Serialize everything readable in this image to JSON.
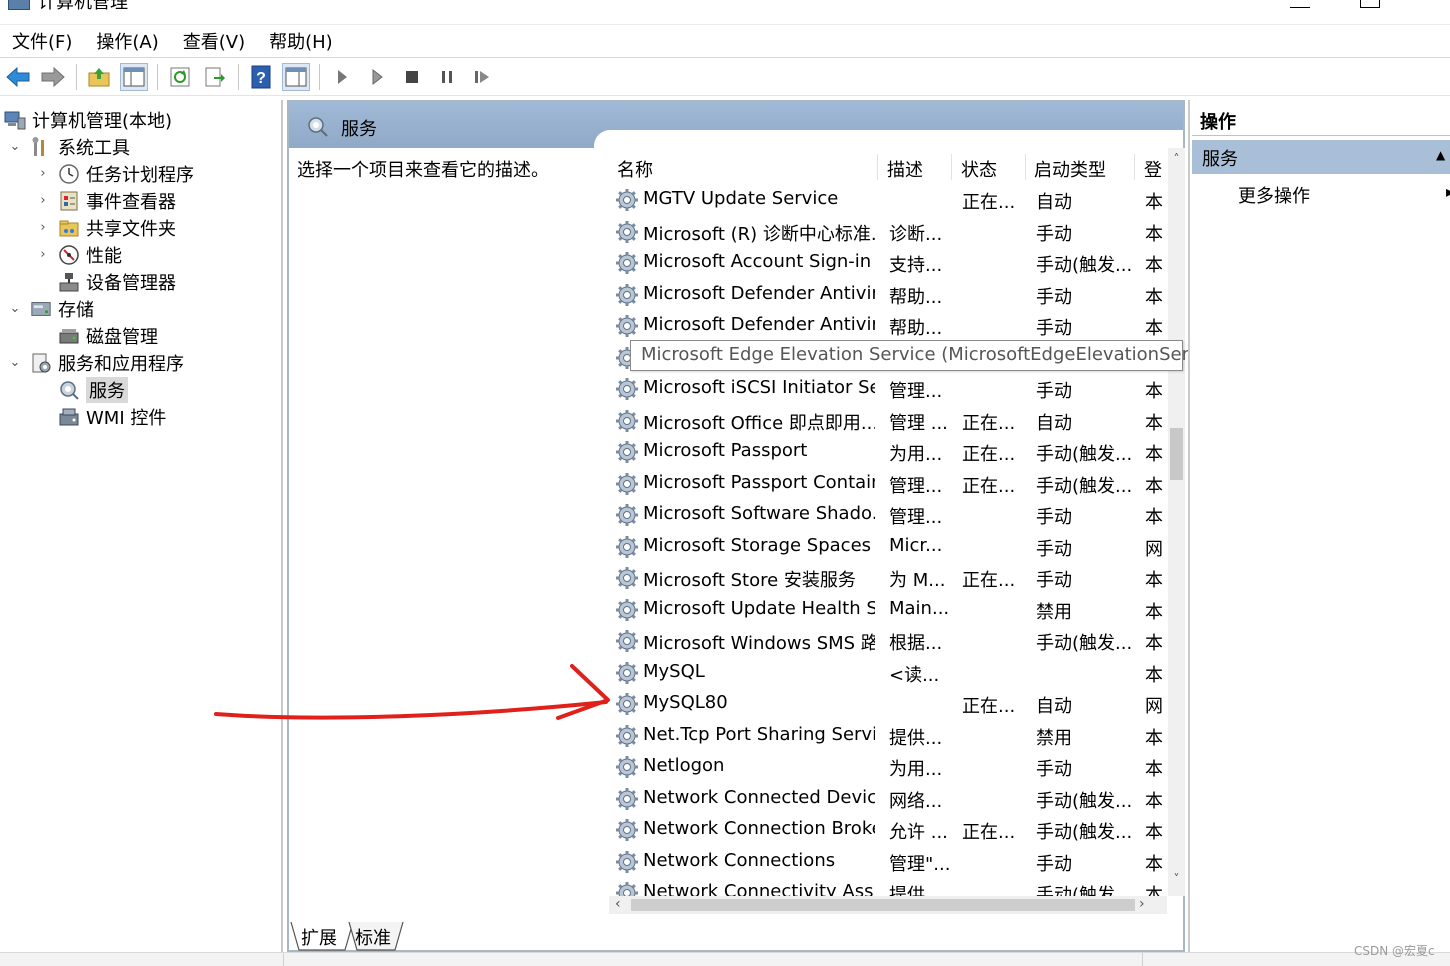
{
  "window": {
    "title": "计算机管理"
  },
  "menubar": [
    "文件(F)",
    "操作(A)",
    "查看(V)",
    "帮助(H)"
  ],
  "tree": {
    "root": "计算机管理(本地)",
    "system_tools": "系统工具",
    "task_scheduler": "任务计划程序",
    "event_viewer": "事件查看器",
    "shared_folders": "共享文件夹",
    "performance": "性能",
    "device_manager": "设备管理器",
    "storage": "存储",
    "disk_management": "磁盘管理",
    "services_apps": "服务和应用程序",
    "services": "服务",
    "wmi": "WMI 控件"
  },
  "center": {
    "title": "服务",
    "description": "选择一个项目来查看它的描述。",
    "columns": {
      "name": "名称",
      "desc": "描述",
      "status": "状态",
      "startup": "启动类型",
      "logon": "登"
    },
    "rows": [
      {
        "name": "MGTV Update Service",
        "desc": "",
        "status": "正在...",
        "startup": "自动",
        "logon": "本"
      },
      {
        "name": "Microsoft (R) 诊断中心标准...",
        "desc": "诊断...",
        "status": "",
        "startup": "手动",
        "logon": "本"
      },
      {
        "name": "Microsoft Account Sign-in ...",
        "desc": "支持...",
        "status": "",
        "startup": "手动(触发...",
        "logon": "本"
      },
      {
        "name": "Microsoft Defender Antivir...",
        "desc": "帮助...",
        "status": "",
        "startup": "手动",
        "logon": "本"
      },
      {
        "name": "Microsoft Defender Antivir...",
        "desc": "帮助...",
        "status": "",
        "startup": "手动",
        "logon": "本"
      },
      {
        "name": "",
        "desc": "",
        "status": "",
        "startup": "",
        "logon": ""
      },
      {
        "name": "Microsoft iSCSI Initiator Ser...",
        "desc": "管理...",
        "status": "",
        "startup": "手动",
        "logon": "本"
      },
      {
        "name": "Microsoft Office 即点即用...",
        "desc": "管理 ...",
        "status": "正在...",
        "startup": "自动",
        "logon": "本"
      },
      {
        "name": "Microsoft Passport",
        "desc": "为用...",
        "status": "正在...",
        "startup": "手动(触发...",
        "logon": "本"
      },
      {
        "name": "Microsoft Passport Container",
        "desc": "管理...",
        "status": "正在...",
        "startup": "手动(触发...",
        "logon": "本"
      },
      {
        "name": "Microsoft Software Shado...",
        "desc": "管理...",
        "status": "",
        "startup": "手动",
        "logon": "本"
      },
      {
        "name": "Microsoft Storage Spaces S...",
        "desc": "Micr...",
        "status": "",
        "startup": "手动",
        "logon": "网"
      },
      {
        "name": "Microsoft Store 安装服务",
        "desc": "为 M...",
        "status": "正在...",
        "startup": "手动",
        "logon": "本"
      },
      {
        "name": "Microsoft Update Health S...",
        "desc": "Main...",
        "status": "",
        "startup": "禁用",
        "logon": "本"
      },
      {
        "name": "Microsoft Windows SMS 路...",
        "desc": "根据...",
        "status": "",
        "startup": "手动(触发...",
        "logon": "本"
      },
      {
        "name": "MySQL",
        "desc": "<读...",
        "status": "",
        "startup": "",
        "logon": "本"
      },
      {
        "name": "MySQL80",
        "desc": "",
        "status": "正在...",
        "startup": "自动",
        "logon": "网"
      },
      {
        "name": "Net.Tcp Port Sharing Service",
        "desc": "提供...",
        "status": "",
        "startup": "禁用",
        "logon": "本"
      },
      {
        "name": "Netlogon",
        "desc": "为用...",
        "status": "",
        "startup": "手动",
        "logon": "本"
      },
      {
        "name": "Network Connected Devic...",
        "desc": "网络...",
        "status": "",
        "startup": "手动(触发...",
        "logon": "本"
      },
      {
        "name": "Network Connection Broker",
        "desc": "允许 ...",
        "status": "正在...",
        "startup": "手动(触发...",
        "logon": "本"
      },
      {
        "name": "Network Connections",
        "desc": "管理\"...",
        "status": "",
        "startup": "手动",
        "logon": "本"
      },
      {
        "name": "Network Connectivity Assis...",
        "desc": "提供...",
        "status": "",
        "startup": "手动(触发...",
        "logon": "本"
      }
    ],
    "tooltip": "Microsoft Edge Elevation Service (MicrosoftEdgeElevationService)",
    "tabs": {
      "extended": "扩展",
      "standard": "标准"
    }
  },
  "actions": {
    "header": "操作",
    "section": "服务",
    "more": "更多操作"
  },
  "watermark": "CSDN @宏夏c",
  "colors": {
    "header_blue": "#9fb9d6",
    "section_blue": "#a9bfd8",
    "annotation_red": "#e0201b"
  }
}
